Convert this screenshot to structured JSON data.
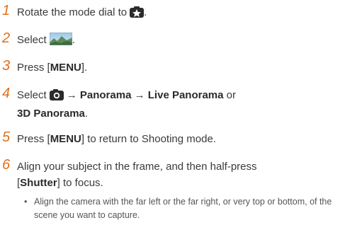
{
  "steps": [
    {
      "num": "1",
      "pre": "Rotate the mode dial to",
      "post": "."
    },
    {
      "num": "2",
      "pre": "Select",
      "post": "."
    },
    {
      "num": "3",
      "pre": "Press [",
      "key": "MENU",
      "post": "]."
    },
    {
      "num": "4",
      "pre": "Select",
      "arrow1": "→",
      "opt1": "Panorama",
      "arrow2": "→",
      "opt2": "Live Panorama",
      "or": "or",
      "opt3": "3D Panorama",
      "post": "."
    },
    {
      "num": "5",
      "pre": "Press [",
      "key": "MENU",
      "post": "] to return to Shooting mode."
    },
    {
      "num": "6",
      "line1": "Align your subject in the frame, and then half-press",
      "pre": "[",
      "key": "Shutter",
      "post": "] to focus."
    }
  ],
  "bullet": {
    "mark": "•",
    "text": "Align the camera with the far left or the far right, or very top or bottom, of the scene you want to capture."
  },
  "icons": {
    "step1": "scene-mode-dial-icon",
    "step2": "panorama-landscape-icon",
    "step4": "camera-menu-icon"
  }
}
